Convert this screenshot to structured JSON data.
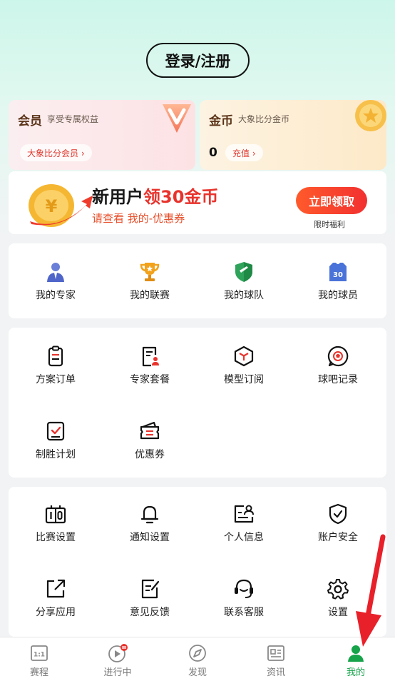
{
  "header": {
    "login_label": "登录/注册"
  },
  "member_card": {
    "title": "会员",
    "subtitle": "享受专属权益",
    "link_label": "大象比分会员 ›"
  },
  "coin_card": {
    "title": "金币",
    "subtitle": "大象比分金币",
    "balance": "0",
    "link_label": "充值 ›"
  },
  "promo_banner": {
    "title_part1": "新用户",
    "title_part2": "领30金币",
    "subtitle": "请查看 我的-优惠券",
    "button_label": "立即领取",
    "note": "限时福利"
  },
  "favorites": [
    {
      "label": "我的专家",
      "icon": "expert-icon"
    },
    {
      "label": "我的联赛",
      "icon": "trophy-icon"
    },
    {
      "label": "我的球队",
      "icon": "team-shield-icon"
    },
    {
      "label": "我的球员",
      "icon": "jersey-icon"
    }
  ],
  "services": [
    {
      "label": "方案订单",
      "icon": "order-doc-icon"
    },
    {
      "label": "专家套餐",
      "icon": "expert-package-icon"
    },
    {
      "label": "模型订阅",
      "icon": "cube-icon"
    },
    {
      "label": "球吧记录",
      "icon": "ball-chat-icon"
    },
    {
      "label": "制胜计划",
      "icon": "plan-check-icon"
    },
    {
      "label": "优惠券",
      "icon": "coupon-icon"
    }
  ],
  "settings": [
    {
      "label": "比赛设置",
      "icon": "scoreboard-icon"
    },
    {
      "label": "通知设置",
      "icon": "bell-icon"
    },
    {
      "label": "个人信息",
      "icon": "profile-card-icon"
    },
    {
      "label": "账户安全",
      "icon": "shield-check-icon"
    },
    {
      "label": "分享应用",
      "icon": "share-icon"
    },
    {
      "label": "意见反馈",
      "icon": "feedback-edit-icon"
    },
    {
      "label": "联系客服",
      "icon": "headset-icon"
    },
    {
      "label": "设置",
      "icon": "gear-icon"
    }
  ],
  "tabbar": [
    {
      "label": "赛程",
      "icon": "schedule-icon"
    },
    {
      "label": "进行中",
      "icon": "live-play-icon"
    },
    {
      "label": "发现",
      "icon": "compass-icon"
    },
    {
      "label": "资讯",
      "icon": "news-icon"
    },
    {
      "label": "我的",
      "icon": "user-icon",
      "active": true
    }
  ],
  "colors": {
    "accent_green": "#16a34a",
    "promo_red": "#e8332c",
    "annotation_arrow": "#e8202a"
  }
}
